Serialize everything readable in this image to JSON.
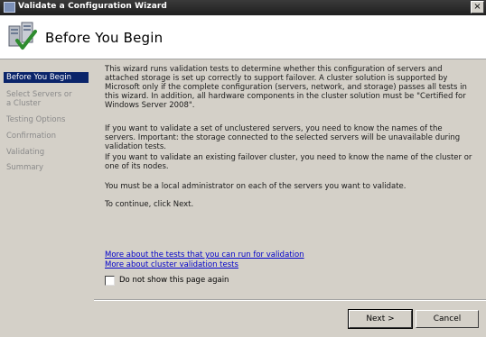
{
  "window": {
    "title": "Validate a Configuration Wizard",
    "close_glyph": "×"
  },
  "header": {
    "title": "Before You Begin",
    "icon": "cluster-validate-icon"
  },
  "sidebar": {
    "items": [
      {
        "label": "Before You Begin",
        "active": true
      },
      {
        "label": "Select Servers or a Cluster",
        "active": false
      },
      {
        "label": "Testing Options",
        "active": false
      },
      {
        "label": "Confirmation",
        "active": false
      },
      {
        "label": "Validating",
        "active": false
      },
      {
        "label": "Summary",
        "active": false
      }
    ]
  },
  "content": {
    "paragraphs": [
      "This wizard runs validation tests to determine whether this configuration of servers and attached storage is set up correctly to support failover. A cluster solution is supported by Microsoft only if the complete configuration (servers, network, and storage) passes all tests in this wizard. In addition, all hardware components in the cluster solution must be \"Certified for Windows Server 2008\".",
      "If you want to validate a set of unclustered servers, you need to know the names of the servers. Important: the storage connected to the selected servers will be unavailable during validation tests.",
      "If you want to validate an existing failover cluster, you need to know the name of the cluster or one of its nodes.",
      "You must be a local administrator on each of the servers you want to validate.",
      "To continue, click Next."
    ],
    "links": [
      "More about the tests that you can run for validation",
      "More about cluster validation tests"
    ],
    "checkbox": {
      "label": "Do not show this page again",
      "checked": false
    }
  },
  "buttons": {
    "next": "Next >",
    "cancel": "Cancel"
  }
}
